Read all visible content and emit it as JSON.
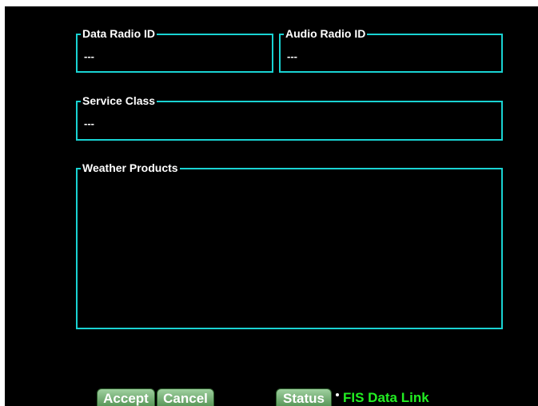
{
  "groups": {
    "data_radio_id": {
      "title": "Data Radio ID",
      "value": "---"
    },
    "audio_radio_id": {
      "title": "Audio Radio ID",
      "value": "---"
    },
    "service_class": {
      "title": "Service Class",
      "value": "---"
    },
    "weather_products": {
      "title": "Weather Products"
    }
  },
  "softkeys": {
    "accept": "Accept",
    "cancel": "Cancel",
    "status": "Status"
  },
  "page_label": "FIS Data Link",
  "colors": {
    "background": "#000000",
    "frame": "#19d3d3",
    "text": "#ffffff",
    "active_page": "#22ee22",
    "softkey": "#5f9f5f"
  }
}
